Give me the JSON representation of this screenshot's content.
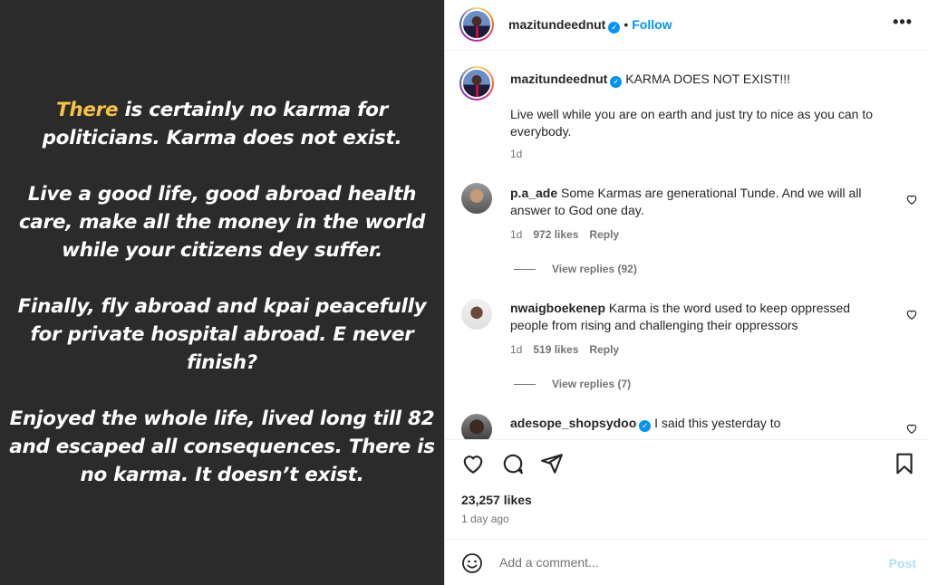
{
  "post_image": {
    "paragraphs": [
      {
        "highlight": "There",
        "rest": " is certainly no karma for politicians. Karma does not exist."
      },
      {
        "highlight": "",
        "rest": "Live a good life, good abroad health care, make all the money in the world while your citizens dey suffer."
      },
      {
        "highlight": "",
        "rest": "Finally, fly abroad and kpai peacefully for private hospital abroad. E never finish?"
      },
      {
        "highlight": "",
        "rest": "Enjoyed the whole life, lived long till 82 and escaped all consequences. There is no karma. It doesn’t exist."
      }
    ],
    "highlight_color": "#f5c242",
    "background_color": "#2b2b2b"
  },
  "header": {
    "username": "mazitundeednut",
    "follow_label": "Follow",
    "dot": "•",
    "more_label": "•••"
  },
  "caption": {
    "username": "mazitundeednut",
    "text_line1": "KARMA DOES NOT EXIST!!!",
    "text_line2": "Live well while you are on earth and just try to nice as you can to everybody.",
    "time": "1d"
  },
  "comments": [
    {
      "username": "p.a_ade",
      "text": "Some Karmas are generational Tunde. And we will all answer to God one day.",
      "time": "1d",
      "likes": "972 likes",
      "reply_label": "Reply",
      "view_replies": "View replies (92)",
      "avatar": "beard-avatar"
    },
    {
      "username": "nwaigboekenep",
      "text": "Karma is the word used to keep oppressed people from rising and challenging their oppressors",
      "time": "1d",
      "likes": "519 likes",
      "reply_label": "Reply",
      "view_replies": "View replies (7)",
      "avatar": "white-avatar"
    },
    {
      "username": "adesope_shopsydoo",
      "text": "I said this yesterday to",
      "verified": true,
      "avatar": "dark-avatar"
    }
  ],
  "actions": {
    "likes": "23,257 likes",
    "time_ago": "1 day ago"
  },
  "add_comment": {
    "placeholder": "Add a comment...",
    "post_label": "Post"
  },
  "colors": {
    "accent": "#0095f6",
    "muted": "#737373",
    "post_disabled": "#b2dffc"
  }
}
